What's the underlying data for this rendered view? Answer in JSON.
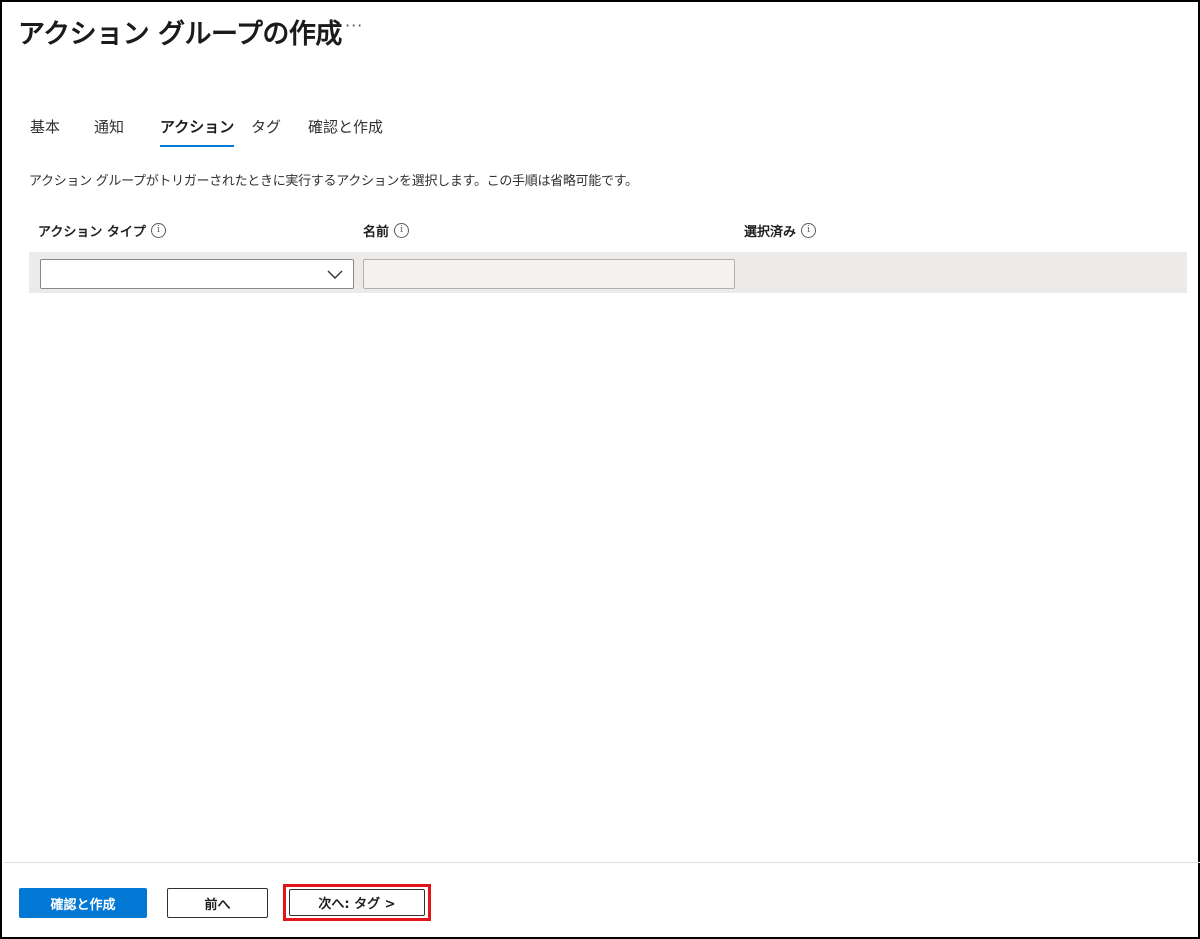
{
  "header": {
    "title": "アクション グループの作成",
    "more_label": "···"
  },
  "tabs": [
    {
      "label": "基本",
      "active": false
    },
    {
      "label": "通知",
      "active": false
    },
    {
      "label": "アクション",
      "active": true
    },
    {
      "label": "タグ",
      "active": false
    },
    {
      "label": "確認と作成",
      "active": false
    }
  ],
  "description": "アクション グループがトリガーされたときに実行するアクションを選択します。この手順は省略可能です。",
  "columns": {
    "action_type": "アクション タイプ",
    "name": "名前",
    "selected": "選択済み"
  },
  "info_glyph": "i",
  "row": {
    "action_type_value": "",
    "name_value": ""
  },
  "footer": {
    "review_create_label": "確認と作成",
    "prev_label": "前へ",
    "next_label": "次へ: タグ >"
  },
  "colors": {
    "accent": "#0078d4",
    "highlight": "#e0161b",
    "row_background": "#edebe9"
  },
  "icons": [
    "more-icon",
    "info-icon",
    "chevron-down-icon"
  ]
}
